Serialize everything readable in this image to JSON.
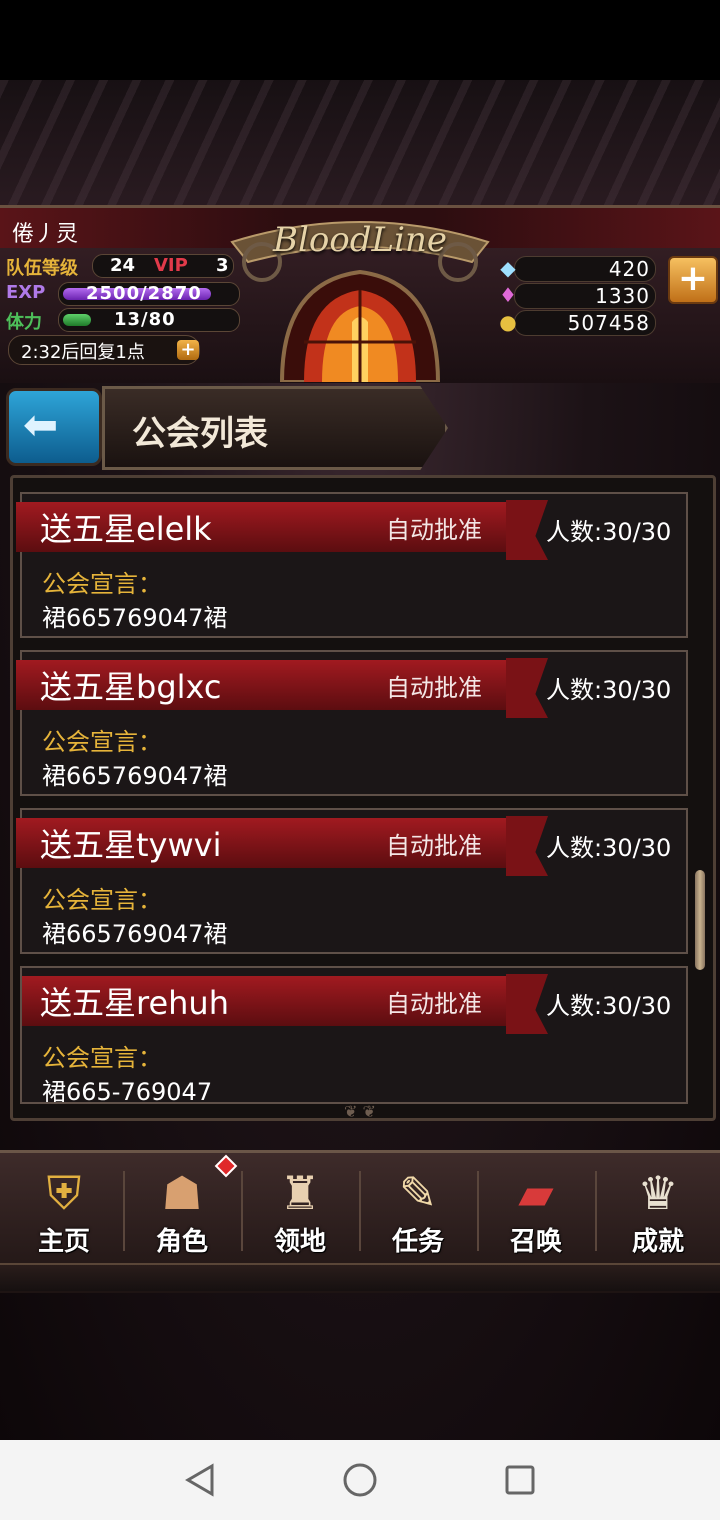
{
  "header": {
    "player_name": "倦丿灵",
    "team_level_label": "队伍等级",
    "team_level": "24",
    "vip_label": "VIP",
    "vip_level": "3",
    "exp_label": "EXP",
    "exp_value": "2500/2870",
    "exp_fraction": 0.871,
    "stamina_label": "体力",
    "stamina_value": "13/80",
    "stamina_fraction": 0.1625,
    "recover_text": "2:32后回复1点",
    "logo_text": "BloodLine",
    "resources": [
      {
        "icon": "crystal-icon",
        "value": "420"
      },
      {
        "icon": "gem-icon",
        "value": "1330"
      },
      {
        "icon": "gold-coin-icon",
        "value": "507458"
      }
    ]
  },
  "title_bar": {
    "title": "公会列表"
  },
  "guilds": [
    {
      "name": "送五星elelk",
      "approval": "自动批准",
      "members": "人数:30/30",
      "decl_label": "公会宣言：",
      "declaration": "裙665769047裙"
    },
    {
      "name": "送五星bglxc",
      "approval": "自动批准",
      "members": "人数:30/30",
      "decl_label": "公会宣言：",
      "declaration": "裙665769047裙"
    },
    {
      "name": "送五星tywvi",
      "approval": "自动批准",
      "members": "人数:30/30",
      "decl_label": "公会宣言：",
      "declaration": "裙665769047裙"
    },
    {
      "name": "送五星rehuh",
      "approval": "自动批准",
      "members": "人数:30/30",
      "decl_label": "公会宣言：",
      "declaration": "裙665-769047"
    }
  ],
  "bottom_nav": [
    {
      "label": "主页",
      "icon": "home-shield-icon"
    },
    {
      "label": "角色",
      "icon": "character-icon"
    },
    {
      "label": "领地",
      "icon": "castle-icon"
    },
    {
      "label": "任务",
      "icon": "quest-book-icon"
    },
    {
      "label": "召唤",
      "icon": "summon-cards-icon"
    },
    {
      "label": "成就",
      "icon": "trophy-icon"
    }
  ],
  "colors": {
    "accent_gold": "#e6b43a",
    "ribbon_red": "#a11a20",
    "exp_purple": "#8a3ad0",
    "stamina_green": "#2f9a3a"
  }
}
